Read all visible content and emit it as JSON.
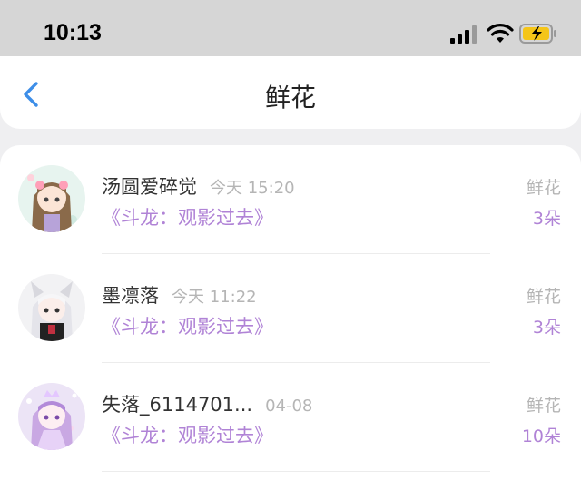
{
  "status_bar": {
    "time": "10:13"
  },
  "nav": {
    "title": "鲜花",
    "back_icon": "chevron-left-icon"
  },
  "colors": {
    "accent": "#b083d6",
    "back": "#3d8ee8",
    "muted": "#b5b5b5"
  },
  "items": [
    {
      "name": "汤圆爱碎觉",
      "time": "今天 15:20",
      "book": "《斗龙：观影过去》",
      "gift": "鲜花",
      "count": "3朵"
    },
    {
      "name": "墨凛落",
      "time": "今天 11:22",
      "book": "《斗龙：观影过去》",
      "gift": "鲜花",
      "count": "3朵"
    },
    {
      "name": "失落_6114701...",
      "time": "04-08",
      "book": "《斗龙：观影过去》",
      "gift": "鲜花",
      "count": "10朵"
    }
  ]
}
